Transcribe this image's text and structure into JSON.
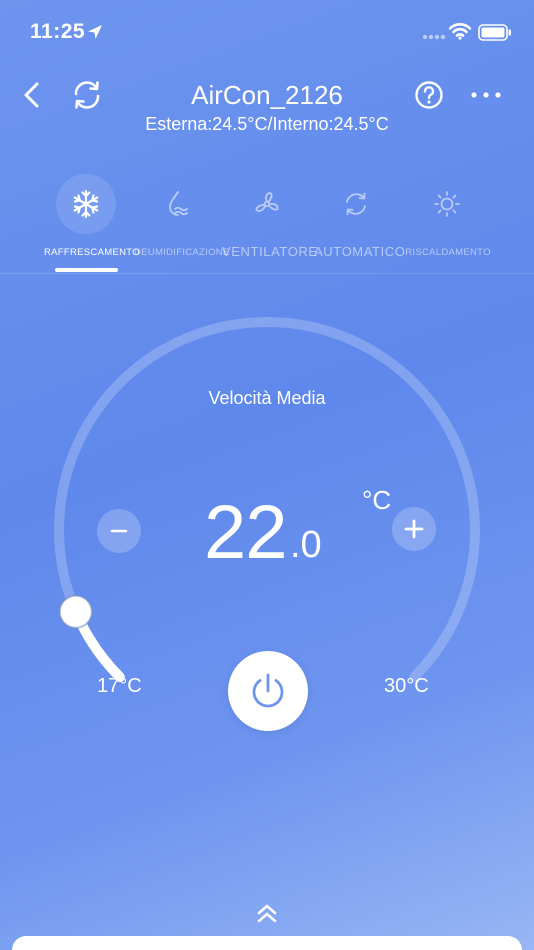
{
  "status_bar": {
    "time": "11:25"
  },
  "header": {
    "title": "AirCon_2126",
    "subtitle": "Esterna:24.5°C/Interno:24.5°C",
    "icons": {
      "back": "chevron-left-icon",
      "refresh": "refresh-icon",
      "help": "help-icon",
      "more": "more-icon"
    }
  },
  "modes": [
    {
      "label": "RAFFRESCAMENTO",
      "icon": "snowflake-icon",
      "active": true
    },
    {
      "label": "DEUMIDIFICAZIONE",
      "icon": "dehumidify-icon",
      "active": false
    },
    {
      "label": "VENTILATORE",
      "icon": "fan-icon",
      "active": false
    },
    {
      "label": "AUTOMATICO",
      "icon": "auto-icon",
      "active": false
    },
    {
      "label": "RISCALDAMENTO",
      "icon": "sun-icon",
      "active": false
    }
  ],
  "thermostat": {
    "fan_speed": "Velocità Media",
    "temperature_whole": "22",
    "temperature_decimal": ".0",
    "unit": "°C",
    "min_label": "17°C",
    "max_label": "30°C",
    "min": 17,
    "max": 30,
    "setpoint": 22.0
  },
  "colors": {
    "accent": "#5f88ec",
    "background": "#6d95ee"
  }
}
